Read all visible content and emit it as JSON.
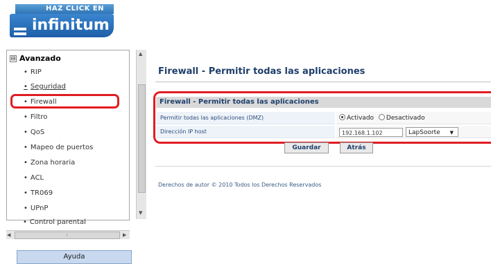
{
  "logo": {
    "tagline": "HAZ CLICK EN",
    "brand": "infinitum"
  },
  "sidebar": {
    "root_toggle": "⊟",
    "root_label": "Avanzado",
    "bullet": "•",
    "items": [
      {
        "label": "RIP"
      },
      {
        "label": "Seguridad"
      },
      {
        "label": "Firewall"
      },
      {
        "label": "Filtro"
      },
      {
        "label": "QoS"
      },
      {
        "label": "Mapeo de puertos"
      },
      {
        "label": "Zona horaria"
      },
      {
        "label": "ACL"
      },
      {
        "label": "TR069"
      },
      {
        "label": "UPnP"
      },
      {
        "label": "Control parental"
      }
    ]
  },
  "help_label": "Ayuda",
  "main": {
    "title": "Firewall - Permitir todas las aplicaciones",
    "panel_header": "Firewall - Permitir todas las aplicaciones",
    "dmz_label": "Permitir todas las aplicaciones (DMZ)",
    "radio_on_label": "Activado",
    "radio_off_label": "Desactivado",
    "ip_label": "Dirección IP host",
    "ip_value": "192.168.1.102",
    "host_value": "LapSoorte",
    "save_label": "Guardar",
    "back_label": "Atrás",
    "footer": "Derechos de autor © 2010 Todos los Derechos Reservados"
  },
  "highlight_color": "#e11b22"
}
